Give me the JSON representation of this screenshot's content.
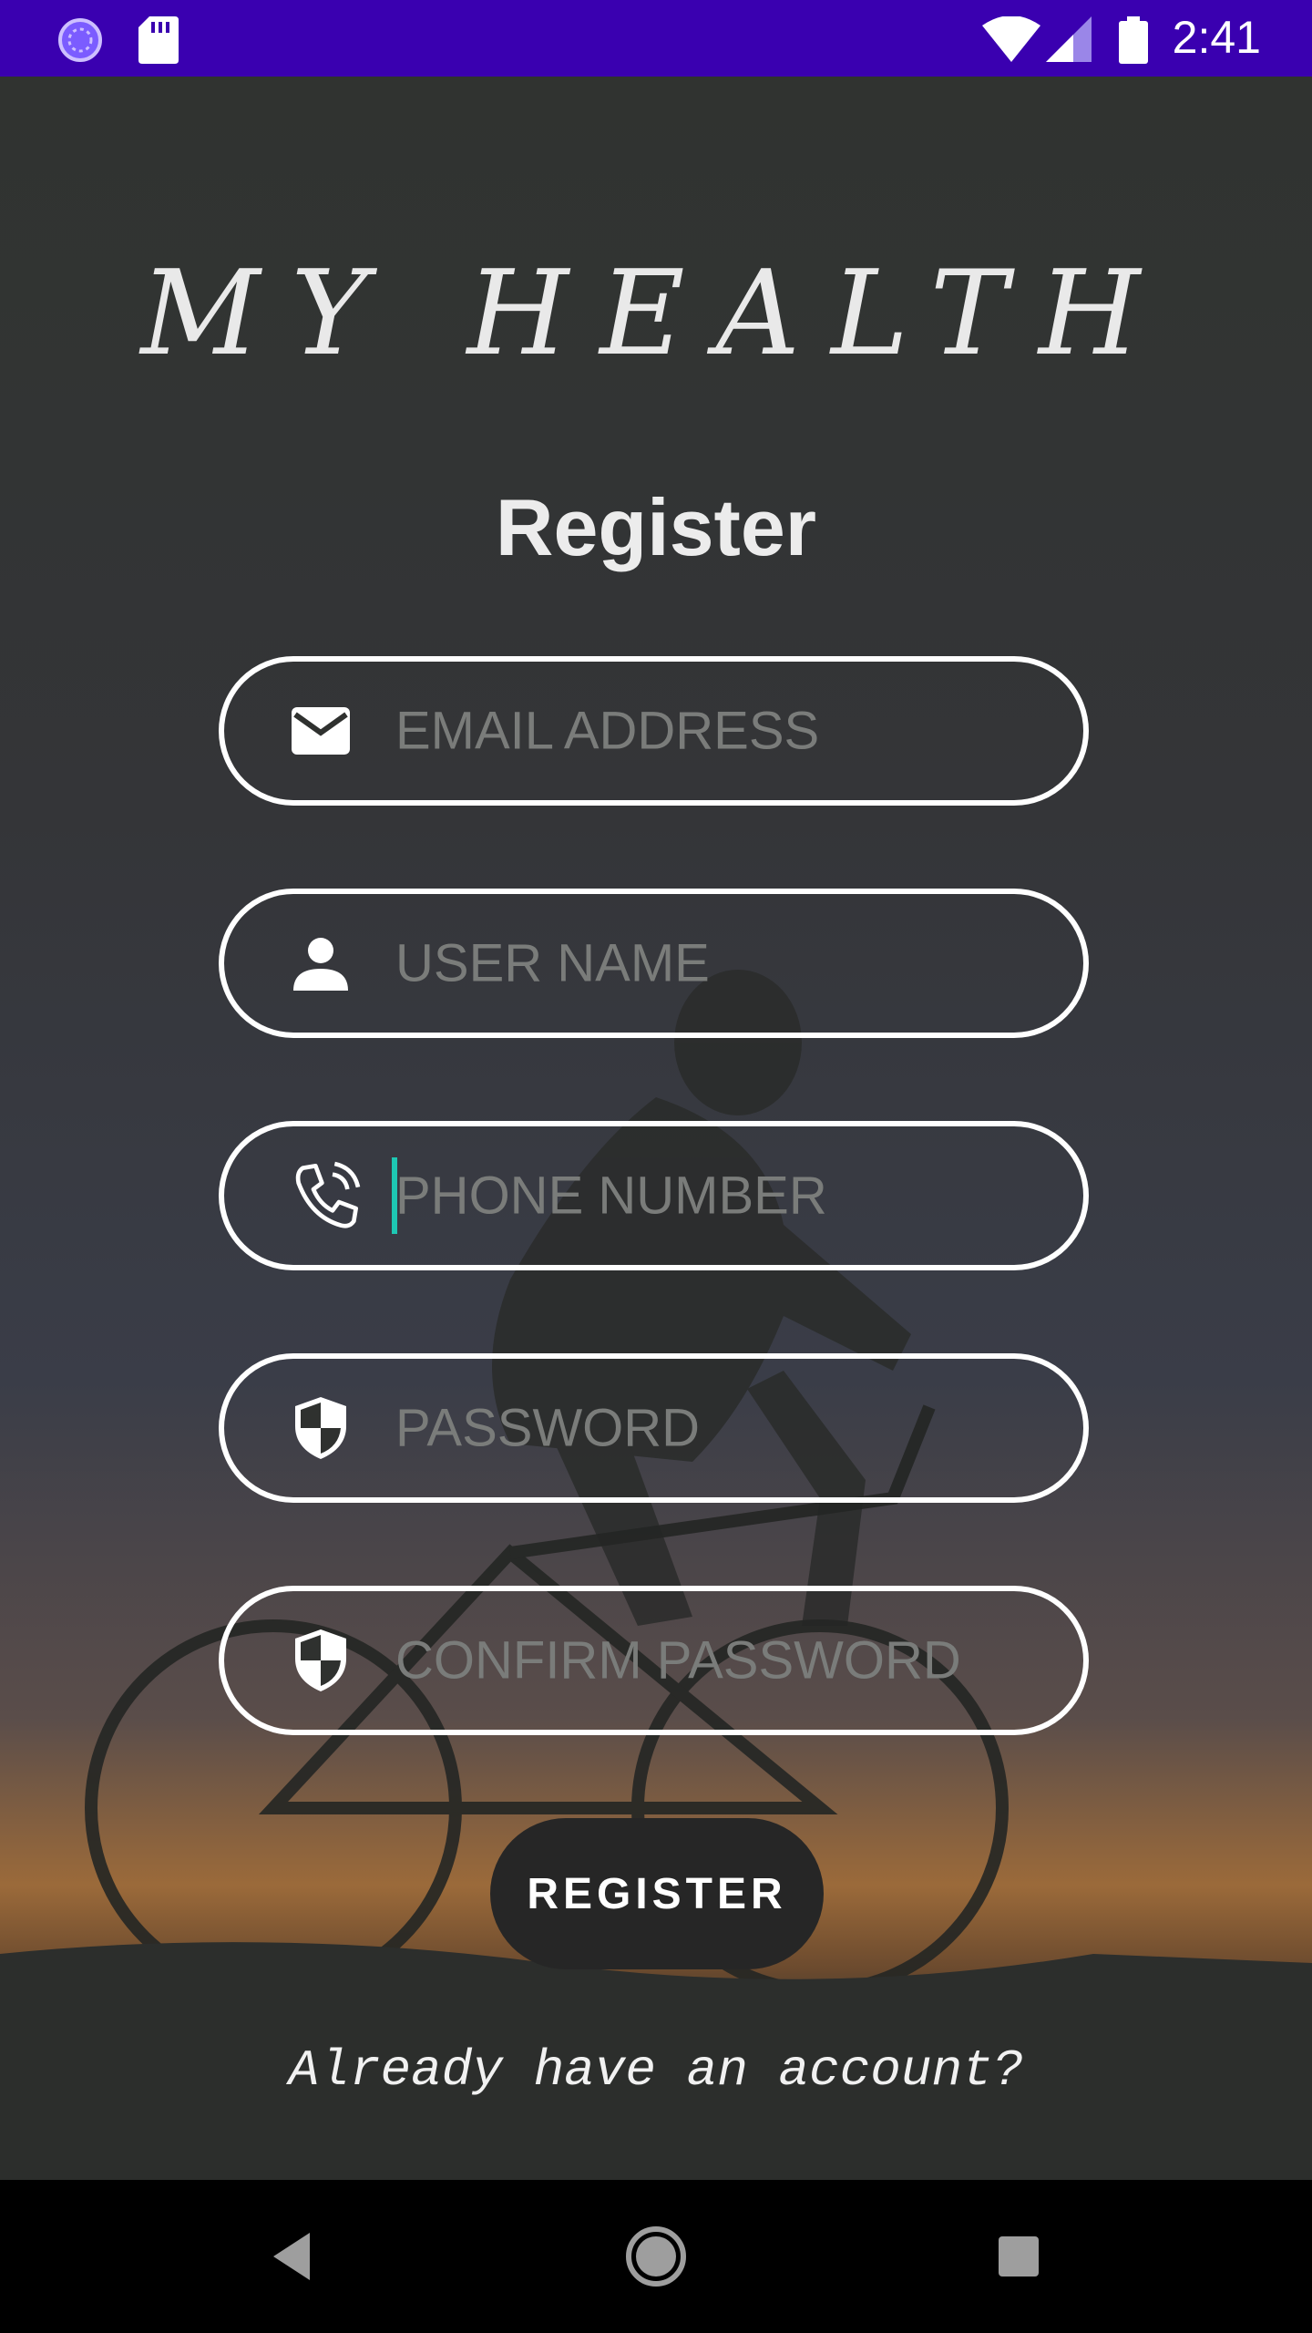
{
  "status_bar": {
    "time": "2:41",
    "left_icons": [
      "loading-icon",
      "sd-card-icon"
    ],
    "right_icons": [
      "wifi-icon",
      "signal-icon",
      "battery-icon"
    ],
    "color": "#3a00b0"
  },
  "app": {
    "title": "MY HEALTH",
    "page_title": "Register"
  },
  "form": {
    "email": {
      "placeholder": "EMAIL ADDRESS",
      "icon": "email-icon"
    },
    "username": {
      "placeholder": "USER NAME",
      "icon": "person-icon"
    },
    "phone": {
      "placeholder": "PHONE NUMBER",
      "icon": "phone-icon",
      "focused": true
    },
    "password": {
      "placeholder": "PASSWORD",
      "icon": "shield-icon"
    },
    "confirm_password": {
      "placeholder": "CONFIRM PASSWORD",
      "icon": "shield-icon"
    }
  },
  "actions": {
    "register_label": "REGISTER",
    "login_link": "Already have an account?"
  },
  "nav_bar": {
    "buttons": [
      "back-icon",
      "home-icon",
      "recents-icon"
    ]
  },
  "colors": {
    "accent_cursor": "#1ec7b3",
    "field_border": "#ffffff",
    "button_bg": "#262626"
  }
}
